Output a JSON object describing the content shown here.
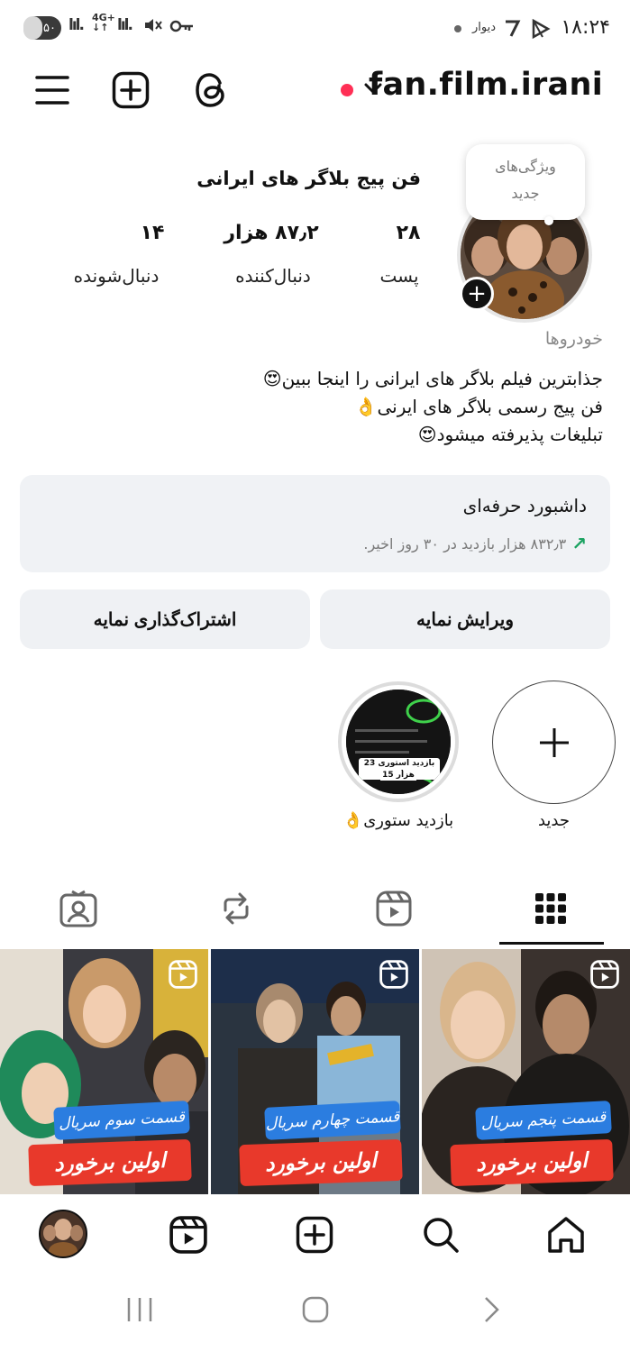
{
  "status_bar": {
    "battery": "۵۰",
    "network": "4G+",
    "clock": "۱۸:۲۴",
    "notif_text": "دیوار",
    "battery_level": 0.5
  },
  "header": {
    "username": "fan.film.irani",
    "menu_icon": "hamburger-menu-icon",
    "create_icon": "plus-square-icon",
    "threads_icon": "threads-icon"
  },
  "profile": {
    "name": "فن پیج  بلاگر های ایرانی",
    "stats": [
      {
        "value": "۲۸",
        "label": "پست"
      },
      {
        "value": "۸۷٫۲ هزار",
        "label": "دنبال‌کننده"
      },
      {
        "value": "۱۴",
        "label": "دنبال‌شونده"
      }
    ],
    "tooltip_line1": "ویژگی‌های",
    "tooltip_line2": "جدید",
    "category": "خودروها",
    "bio": [
      "جذابترین فیلم  بلاگر های ایرانی را اینجا ببین😍",
      "فن پیج رسمی بلاگر های ایرنی👌",
      "تبلیغات پذیرفته میشود😍"
    ]
  },
  "dashboard": {
    "title": "داشبورد حرفه‌ای",
    "subtitle": "۸۳۲٫۳ هزار بازدید در ۳۰ روز اخیر."
  },
  "buttons": {
    "edit": "ویرایش نمایه",
    "share": "اشتراک‌گذاری نمایه"
  },
  "highlights": [
    {
      "label": "جدید"
    },
    {
      "label": "بازدید ستوری👌",
      "caption": "بازدید استوری 23 ساعت",
      "caption2": "15 هزار"
    }
  ],
  "tabs": [
    "grid-icon",
    "reels-icon",
    "reposts-icon",
    "tagged-icon"
  ],
  "posts": [
    {
      "blue": "قسمت پنجم سریال",
      "red": "اولین برخورد"
    },
    {
      "blue": "قسمت چهارم سریال",
      "red": "اولین برخورد"
    },
    {
      "blue": "قسمت سوم سریال",
      "red": "اولین برخورد"
    }
  ],
  "bottom_nav": [
    "home-icon",
    "search-icon",
    "create-icon",
    "reels-icon",
    "profile-avatar"
  ]
}
